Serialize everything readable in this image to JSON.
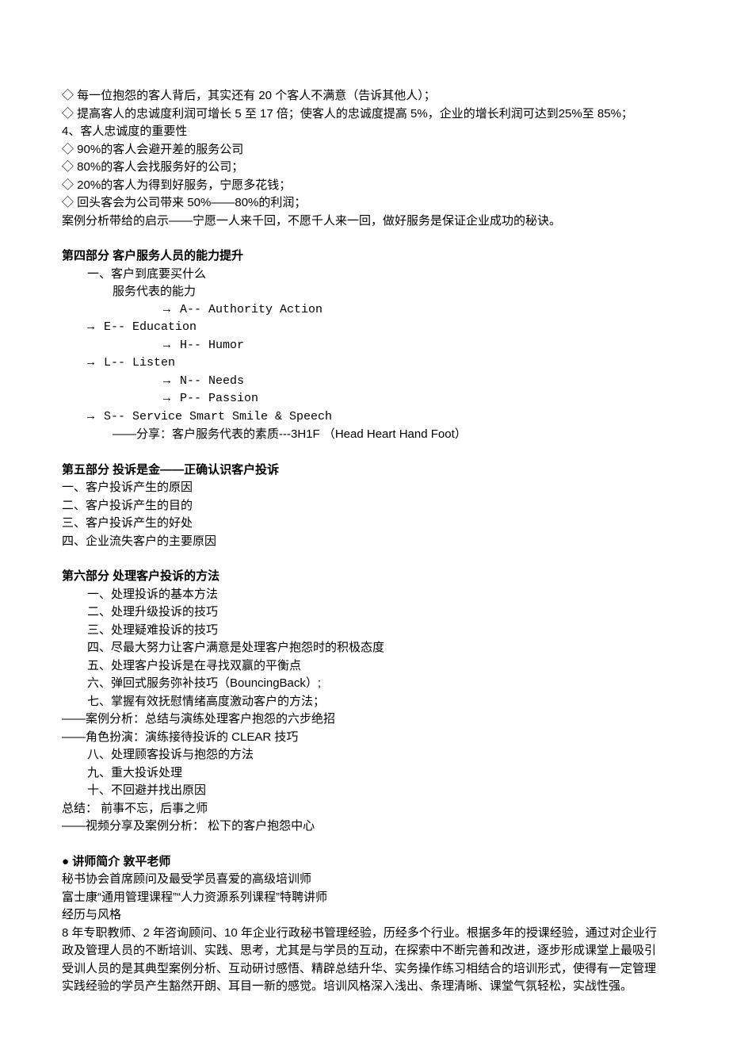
{
  "intro": {
    "lines": [
      "◇ 每一位抱怨的客人背后，其实还有 20 个客人不满意（告诉其他人）；",
      "◇ 提高客人的忠诚度利润可增长 5 至 17 倍；使客人的忠诚度提高 5%，企业的增长利润可达到25%至 85%；",
      "4、客人忠诚度的重要性",
      "◇ 90%的客人会避开差的服务公司",
      "◇ 80%的客人会找服务好的公司；",
      "◇ 20%的客人为得到好服务，宁愿多花钱；",
      "◇ 回头客会为公司带来 50%——80%的利润；",
      "案例分析带给的启示——宁愿一人来千回，不愿千人来一回，做好服务是保证企业成功的秘诀。"
    ]
  },
  "section4": {
    "heading": "第四部分 客户服务人员的能力提升",
    "lines": [
      {
        "text": "一、客户到底要买什么",
        "ind": 1,
        "arrow": false,
        "mono": false
      },
      {
        "text": "服务代表的能力",
        "ind": 2,
        "arrow": false,
        "mono": false
      },
      {
        "text": "A-- Authority Action",
        "ind": 3,
        "arrow": true,
        "mono": true
      },
      {
        "text": "E-- Education",
        "ind": 1,
        "arrow": true,
        "mono": true
      },
      {
        "text": "H-- Humor",
        "ind": 3,
        "arrow": true,
        "mono": true
      },
      {
        "text": "L-- Listen",
        "ind": 1,
        "arrow": true,
        "mono": true
      },
      {
        "text": "N-- Needs",
        "ind": 3,
        "arrow": true,
        "mono": true
      },
      {
        "text": "P-- Passion",
        "ind": 3,
        "arrow": true,
        "mono": true
      },
      {
        "text": "S-- Service Smart Smile & Speech",
        "ind": 1,
        "arrow": true,
        "mono": true
      },
      {
        "text": "——分享：客户服务代表的素质---3H1F  （Head Heart Hand Foot）",
        "ind": 2,
        "arrow": false,
        "mono": false
      }
    ]
  },
  "section5": {
    "heading": "第五部分  投诉是金——正确认识客户投诉",
    "lines": [
      "一、客户投诉产生的原因",
      "二、客户投诉产生的目的",
      "三、客户投诉产生的好处",
      "四、企业流失客户的主要原因"
    ]
  },
  "section6": {
    "heading": "第六部分  处理客户投诉的方法",
    "lines": [
      {
        "text": "一、处理投诉的基本方法",
        "ind": 1
      },
      {
        "text": "二、处理升级投诉的技巧",
        "ind": 1
      },
      {
        "text": "三、处理疑难投诉的技巧",
        "ind": 1
      },
      {
        "text": "四、尽最大努力让客户满意是处理客户抱怨时的积极态度",
        "ind": 1
      },
      {
        "text": "五、处理客户投诉是在寻找双赢的平衡点",
        "ind": 1
      },
      {
        "text": "六、弹回式服务弥补技巧（BouncingBack）;",
        "ind": 1
      },
      {
        "text": "七、掌握有效抚慰情绪高度激动客户的方法；",
        "ind": 1
      },
      {
        "text": "——案例分析：总结与演练处理客户抱怨的六步绝招",
        "ind": 0
      },
      {
        "text": "——角色扮演：演练接待投诉的 CLEAR 技巧",
        "ind": 0
      },
      {
        "text": "八、处理顾客投诉与抱怨的方法",
        "ind": 1
      },
      {
        "text": "九、重大投诉处理",
        "ind": 1
      },
      {
        "text": "十、不回避并找出原因",
        "ind": 1
      },
      {
        "text": "总结：   前事不忘，后事之师",
        "ind": 0
      },
      {
        "text": "——视频分享及案例分析： 松下的客户抱怨中心",
        "ind": 0
      }
    ]
  },
  "instructor": {
    "heading": "● 讲师简介 敦平老师",
    "lines": [
      "秘书协会首席顾问及最受学员喜爱的高级培训师",
      "富士康“通用管理课程”“人力资源系列课程”特聘讲师",
      "经历与风格",
      "8 年专职教师、2 年咨询顾问、10 年企业行政秘书管理经验，历经多个行业。根据多年的授课经验，通过对企业行政及管理人员的不断培训、实践、思考，尤其是与学员的互动，在探索中不断完善和改进，逐步形成课堂上最吸引受训人员的是其典型案例分析、互动研讨感悟、精辟总结升华、实务操作练习相结合的培训形式，使得有一定管理实践经验的学员产生豁然开朗、耳目一新的感觉。培训风格深入浅出、条理清晰、课堂气氛轻松，实战性强。"
    ]
  }
}
